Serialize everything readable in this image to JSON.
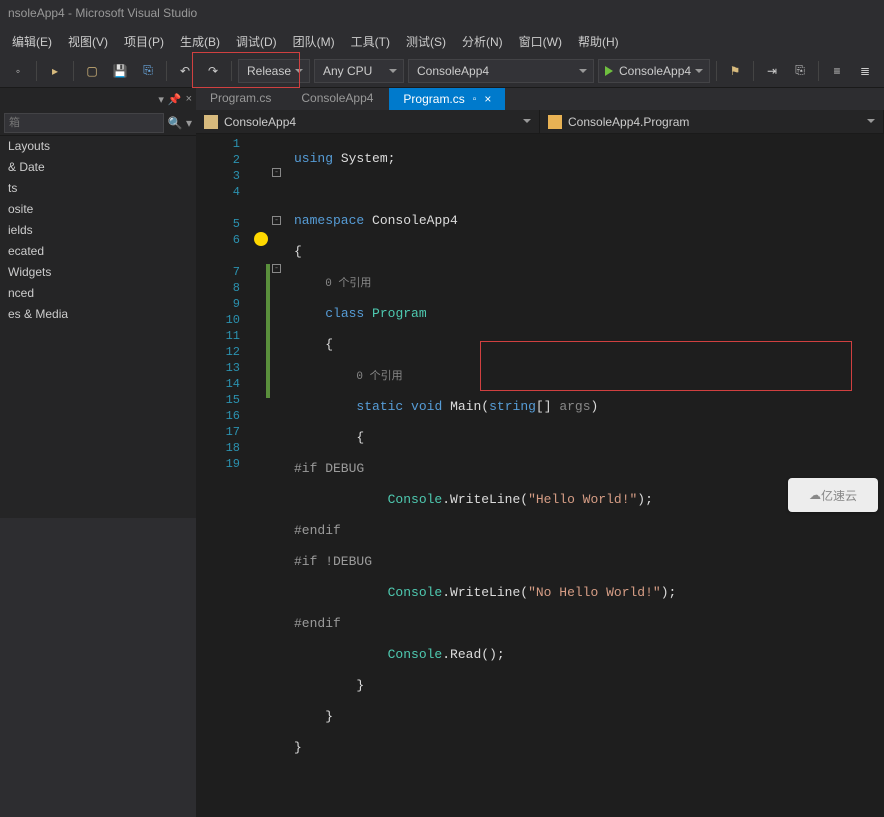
{
  "title": "nsoleApp4 - Microsoft Visual Studio",
  "menu": [
    "编辑(E)",
    "视图(V)",
    "项目(P)",
    "生成(B)",
    "调试(D)",
    "团队(M)",
    "工具(T)",
    "测试(S)",
    "分析(N)",
    "窗口(W)",
    "帮助(H)"
  ],
  "toolbar": {
    "config": "Release",
    "platform": "Any CPU",
    "startup": "ConsoleApp4",
    "start": "ConsoleApp4"
  },
  "sidebar": {
    "search_placeholder": "箱",
    "items": [
      "Layouts",
      "& Date",
      "ts",
      "osite",
      "ields",
      "ecated",
      "Widgets",
      "nced",
      "es & Media"
    ]
  },
  "tabs": [
    {
      "label": "Program.cs",
      "active": false
    },
    {
      "label": "ConsoleApp4",
      "active": false
    },
    {
      "label": "Program.cs",
      "active": true
    }
  ],
  "nav": {
    "left": "ConsoleApp4",
    "right": "ConsoleApp4.Program"
  },
  "code": {
    "lines": [
      "1",
      "2",
      "3",
      "4",
      "5",
      "6",
      "7",
      "8",
      "9",
      "10",
      "11",
      "12",
      "13",
      "14",
      "15",
      "16",
      "17",
      "18",
      "19"
    ],
    "using": "using",
    "system": "System",
    "namespace": "namespace",
    "ns": "ConsoleApp4",
    "ref0a": "0 个引用",
    "class": "class",
    "program": "Program",
    "ref0b": "0 个引用",
    "static": "static",
    "void": "void",
    "main": "Main",
    "string": "string",
    "args": "args",
    "ifdebug": "#if DEBUG",
    "console": "Console",
    "writeline": "WriteLine",
    "hello": "\"Hello World!\"",
    "endif1": "#endif",
    "ifndebug": "#if !DEBUG",
    "nohello": "\"No Hello World!\"",
    "endif2": "#endif",
    "read": "Read"
  },
  "watermark": "亿速云"
}
